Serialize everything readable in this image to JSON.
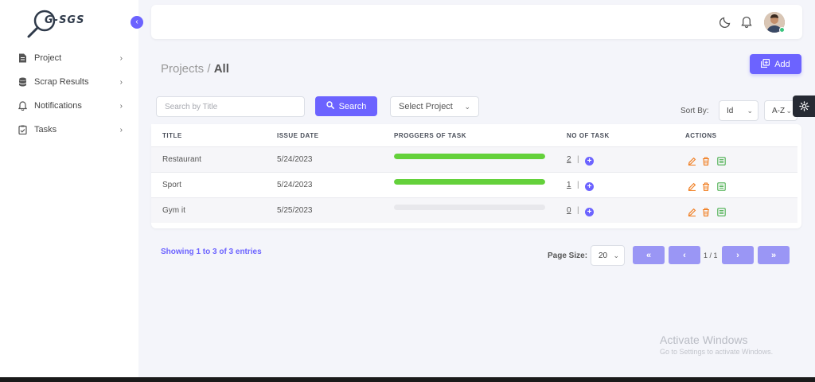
{
  "app": {
    "logo_text": "G-SGS"
  },
  "sidebar": {
    "items": [
      {
        "label": "Project",
        "icon": "document-icon"
      },
      {
        "label": "Scrap Results",
        "icon": "database-icon"
      },
      {
        "label": "Notifications",
        "icon": "bell-icon"
      },
      {
        "label": "Tasks",
        "icon": "clipboard-icon"
      }
    ]
  },
  "topbar": {
    "icons": [
      "moon-icon",
      "bell-icon"
    ],
    "avatar_status": "online"
  },
  "header": {
    "section": "Projects",
    "separator": "/",
    "current": "All",
    "add_label": "Add"
  },
  "filters": {
    "search_placeholder": "Search by Title",
    "search_label": "Search",
    "project_select": "Select Project",
    "sort_label": "Sort By:",
    "sort_field": "Id",
    "sort_order": "A-Z"
  },
  "table": {
    "columns": [
      "TITLE",
      "ISSUE DATE",
      "PROGGERS OF TASK",
      "NO OF TASK",
      "ACTIONS"
    ],
    "rows": [
      {
        "title": "Restaurant",
        "issue_date": "5/24/2023",
        "progress": 1.0,
        "tasks": "2"
      },
      {
        "title": "Sport",
        "issue_date": "5/24/2023",
        "progress": 1.0,
        "tasks": "1"
      },
      {
        "title": "Gym it",
        "issue_date": "5/25/2023",
        "progress": 0.0,
        "tasks": "0"
      }
    ],
    "task_separator": "|"
  },
  "footer": {
    "showing": "Showing 1 to 3 of 3 entries",
    "page_size_label": "Page Size:",
    "page_size": "20",
    "page_info": "1 / 1",
    "buttons": {
      "first": "«",
      "prev": "‹",
      "next": "›",
      "last": "»"
    }
  },
  "watermark": {
    "title": "Activate Windows",
    "subtitle": "Go to Settings to activate Windows."
  },
  "colors": {
    "accent": "#6c63ff",
    "progress": "#64d13b",
    "edit": "#f07a1a",
    "delete": "#f07a1a",
    "details": "#4caf50"
  }
}
